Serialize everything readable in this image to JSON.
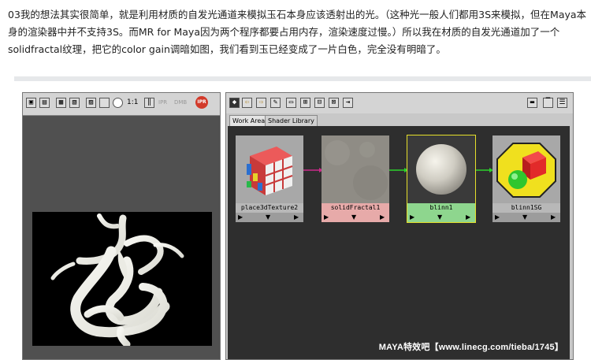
{
  "article": {
    "text": "03我的想法其实很简单，就是利用材质的自发光通道来模拟玉石本身应该透射出的光。（这种光一般人们都用3S来模拟，但在Maya本身的渲染器中并不支持3S。而MR for Maya因为两个程序都要占用内存，渲染速度过慢。）所以我在材质的自发光通道加了一个solidfractal纹理，把它的color gain调暗如图，我们看到玉已经变成了一片白色，完全没有明暗了。"
  },
  "render_view": {
    "toolbar": {
      "zoom_label": "1:1",
      "ipr_label": "IPR",
      "dmb_label": "DMB",
      "ipr_badge": "IPR"
    }
  },
  "hypershade": {
    "tabs": [
      "Work Area",
      "Shader Library"
    ],
    "nodes": [
      {
        "name": "place3dTexture2"
      },
      {
        "name": "solidFractal1"
      },
      {
        "name": "blinn1"
      },
      {
        "name": "blinn1SG"
      }
    ],
    "watermark": "MAYA特效吧【www.linecg.com/tieba/1745】"
  },
  "colors": {
    "node_label_default": "#b8b8b8",
    "node_label_solidfractal": "#e7aaa9",
    "node_label_blinn": "#8ed68e",
    "connection_pink": "#cc2a8a",
    "connection_green": "#2bd22b",
    "selected_border": "#e6df2a",
    "work_area_bg": "#2e2e2e"
  },
  "icons": [
    "render-icon",
    "snapshot-icon",
    "keep-image-icon",
    "remove-image-icon",
    "color-channel-icon",
    "alpha-channel-icon",
    "pause-icon",
    "forward-arrow-icon",
    "back-arrow-icon",
    "graph-icon",
    "layout-icon",
    "erase-icon"
  ]
}
